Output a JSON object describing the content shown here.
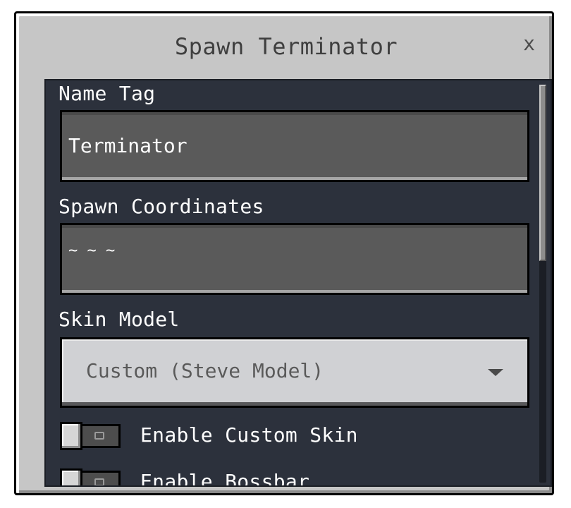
{
  "dialog": {
    "title": "Spawn Terminator",
    "close_label": "x"
  },
  "form": {
    "name_tag": {
      "label": "Name Tag",
      "value": "Terminator"
    },
    "spawn_coordinates": {
      "label": "Spawn Coordinates",
      "value": "~ ~ ~"
    },
    "skin_model": {
      "label": "Skin Model",
      "selected": "Custom (Steve Model)"
    },
    "toggles": [
      {
        "label": "Enable Custom Skin",
        "state": "off"
      },
      {
        "label": "Enable Bossbar",
        "state": "off"
      }
    ]
  },
  "icons": {
    "close": "close-icon",
    "dropdown": "chevron-down-icon"
  },
  "colors": {
    "panel_bg": "#c6c6c6",
    "content_bg": "#2c313c",
    "field_bg": "#5a5a5a",
    "dropdown_bg": "#d0d1d4",
    "text_light": "#ffffff",
    "text_dark": "#3f3f3f"
  }
}
